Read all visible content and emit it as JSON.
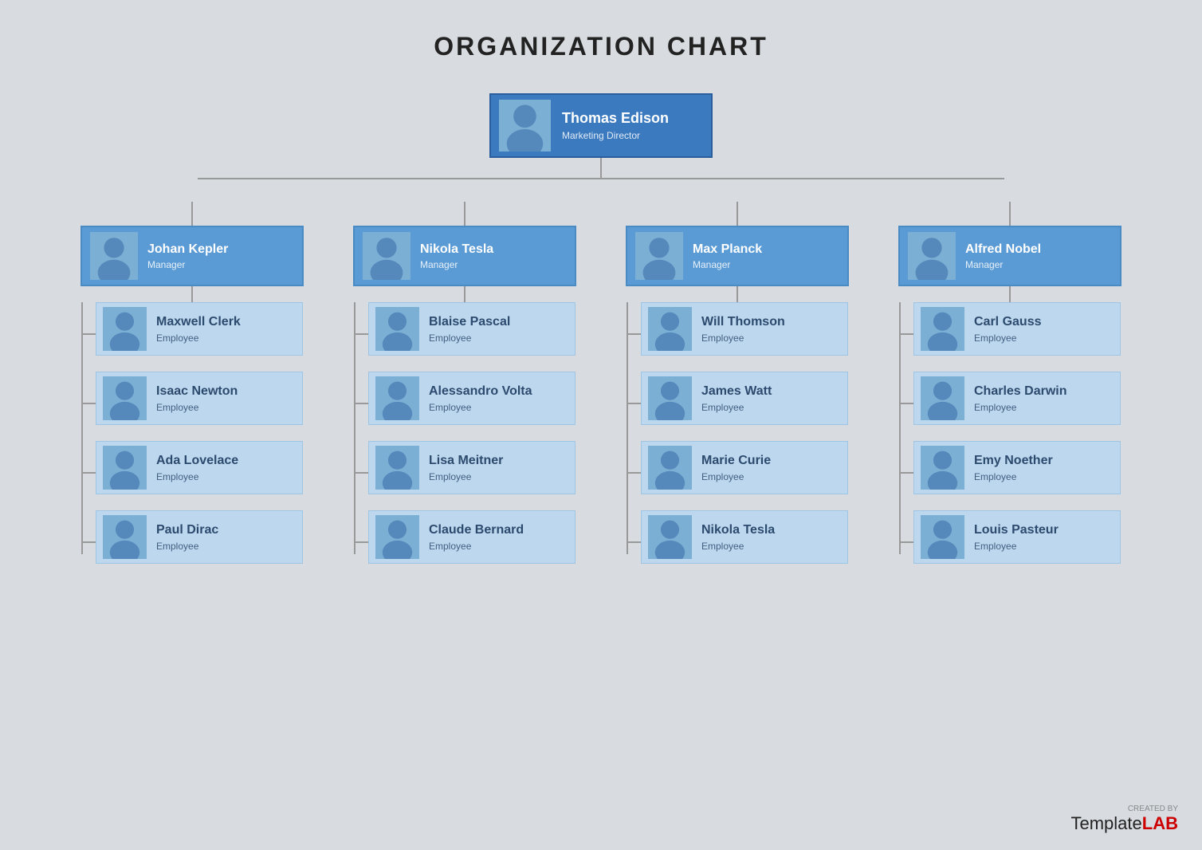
{
  "title": "ORGANIZATION CHART",
  "top": {
    "name": "Thomas Edison",
    "role": "Marketing Director"
  },
  "branches": [
    {
      "manager": {
        "name": "Johan Kepler",
        "role": "Manager"
      },
      "employees": [
        {
          "name": "Maxwell Clerk",
          "role": "Employee"
        },
        {
          "name": "Isaac Newton",
          "role": "Employee"
        },
        {
          "name": "Ada Lovelace",
          "role": "Employee"
        },
        {
          "name": "Paul Dirac",
          "role": "Employee"
        }
      ]
    },
    {
      "manager": {
        "name": "Nikola Tesla",
        "role": "Manager"
      },
      "employees": [
        {
          "name": "Blaise Pascal",
          "role": "Employee"
        },
        {
          "name": "Alessandro Volta",
          "role": "Employee"
        },
        {
          "name": "Lisa Meitner",
          "role": "Employee"
        },
        {
          "name": "Claude Bernard",
          "role": "Employee"
        }
      ]
    },
    {
      "manager": {
        "name": "Max Planck",
        "role": "Manager"
      },
      "employees": [
        {
          "name": "Will Thomson",
          "role": "Employee"
        },
        {
          "name": "James Watt",
          "role": "Employee"
        },
        {
          "name": "Marie Curie",
          "role": "Employee"
        },
        {
          "name": "Nikola Tesla",
          "role": "Employee"
        }
      ]
    },
    {
      "manager": {
        "name": "Alfred Nobel",
        "role": "Manager"
      },
      "employees": [
        {
          "name": "Carl Gauss",
          "role": "Employee"
        },
        {
          "name": "Charles Darwin",
          "role": "Employee"
        },
        {
          "name": "Emy Noether",
          "role": "Employee"
        },
        {
          "name": "Louis Pasteur",
          "role": "Employee"
        }
      ]
    }
  ],
  "watermark": {
    "created_by": "CREATED BY",
    "template": "Template",
    "lab": "LAB"
  }
}
